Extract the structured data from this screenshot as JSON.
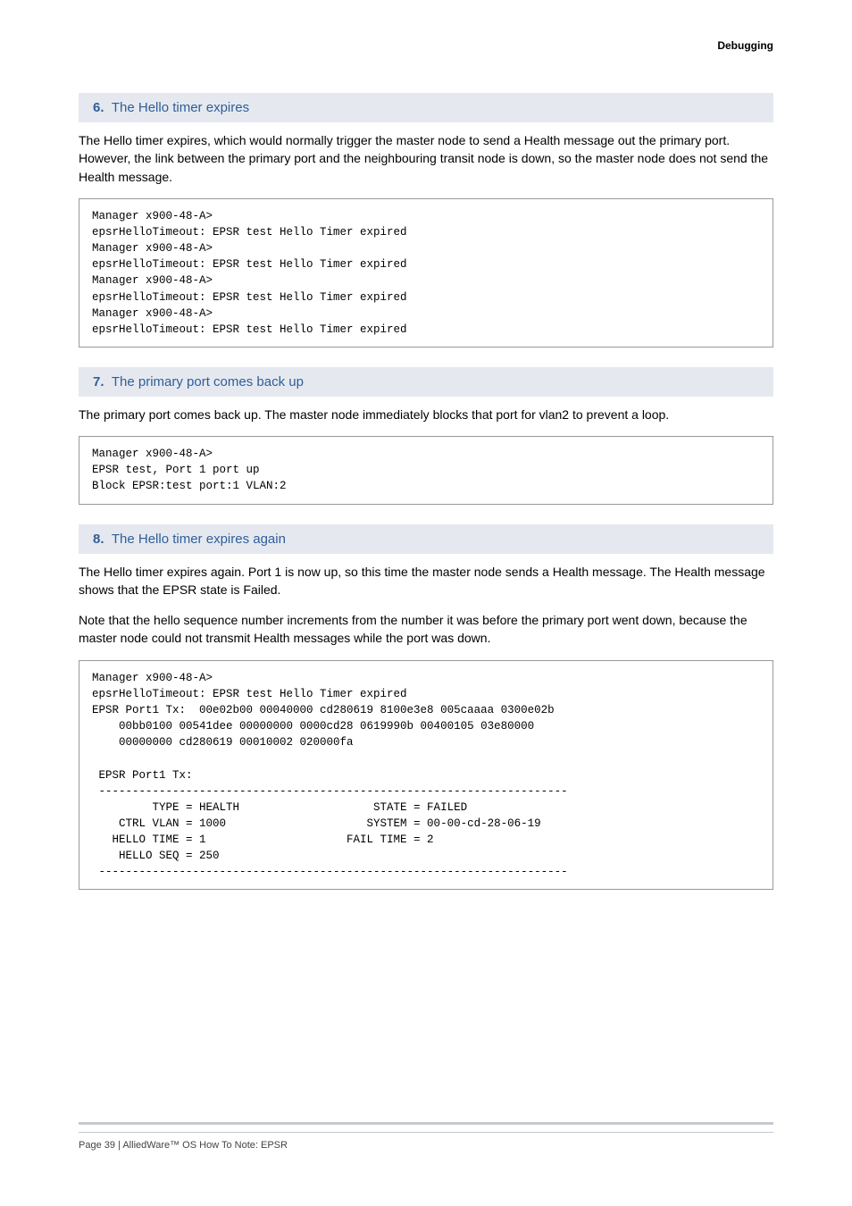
{
  "header": {
    "sectionLabel": "Debugging"
  },
  "steps": [
    {
      "num": "6.",
      "title": "The Hello timer expires",
      "body": "The Hello timer expires, which would normally trigger the master node to send a Health message out the primary port. However, the link between the primary port and the neighbouring transit node is down, so the master node does not send the Health message.",
      "code": "Manager x900-48-A>\nepsrHelloTimeout: EPSR test Hello Timer expired\nManager x900-48-A>\nepsrHelloTimeout: EPSR test Hello Timer expired\nManager x900-48-A>\nepsrHelloTimeout: EPSR test Hello Timer expired\nManager x900-48-A>\nepsrHelloTimeout: EPSR test Hello Timer expired"
    },
    {
      "num": "7.",
      "title": "The primary port comes back up",
      "body": "The primary port comes back up. The master node immediately blocks that port for vlan2 to prevent a loop.",
      "code": "Manager x900-48-A>\nEPSR test, Port 1 port up\nBlock EPSR:test port:1 VLAN:2"
    },
    {
      "num": "8.",
      "title": "The Hello timer expires again",
      "body": "The Hello timer expires again. Port 1 is now up, so this time the master node sends a Health message. The Health message shows that the EPSR state is Failed.",
      "body2": "Note that the hello sequence number increments from the number it was before the primary port went down, because the master node could not transmit Health messages while the port was down.",
      "code": "Manager x900-48-A>\nepsrHelloTimeout: EPSR test Hello Timer expired\nEPSR Port1 Tx:  00e02b00 00040000 cd280619 8100e3e8 005caaaa 0300e02b\n    00bb0100 00541dee 00000000 0000cd28 0619990b 00400105 03e80000\n    00000000 cd280619 00010002 020000fa\n\n EPSR Port1 Tx:\n ----------------------------------------------------------------------\n         TYPE = HEALTH                    STATE = FAILED\n    CTRL VLAN = 1000                     SYSTEM = 00-00-cd-28-06-19\n   HELLO TIME = 1                     FAIL TIME = 2\n    HELLO SEQ = 250\n ----------------------------------------------------------------------"
    }
  ],
  "footer": {
    "text": "Page 39 | AlliedWare™ OS How To Note: EPSR"
  }
}
